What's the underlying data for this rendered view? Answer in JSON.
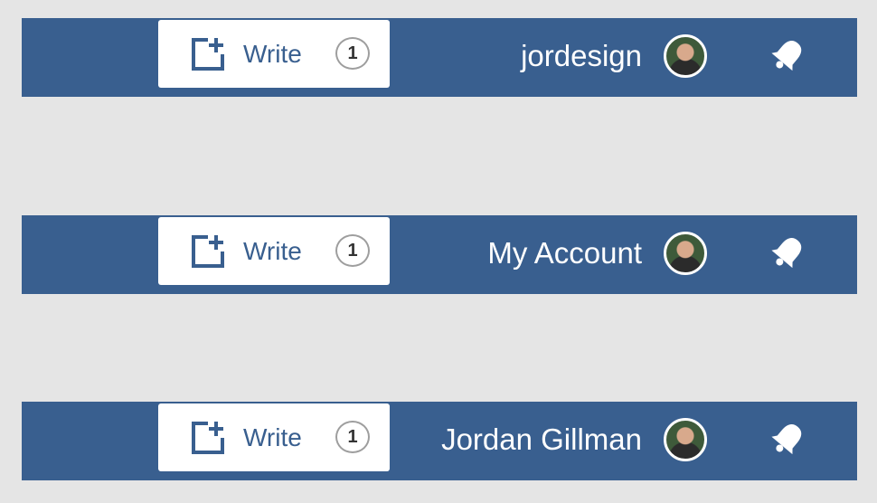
{
  "colors": {
    "bar": "#395f8f",
    "write_accent": "#395f8f",
    "background": "#e5e5e5"
  },
  "variants": [
    {
      "write_label": "Write",
      "count": "1",
      "account_label": "jordesign",
      "icons": [
        "write-plus-icon",
        "avatar",
        "notification-bell-icon"
      ]
    },
    {
      "write_label": "Write",
      "count": "1",
      "account_label": "My Account",
      "icons": [
        "write-plus-icon",
        "avatar",
        "notification-bell-icon"
      ]
    },
    {
      "write_label": "Write",
      "count": "1",
      "account_label": "Jordan Gillman",
      "icons": [
        "write-plus-icon",
        "avatar",
        "notification-bell-icon"
      ]
    }
  ]
}
